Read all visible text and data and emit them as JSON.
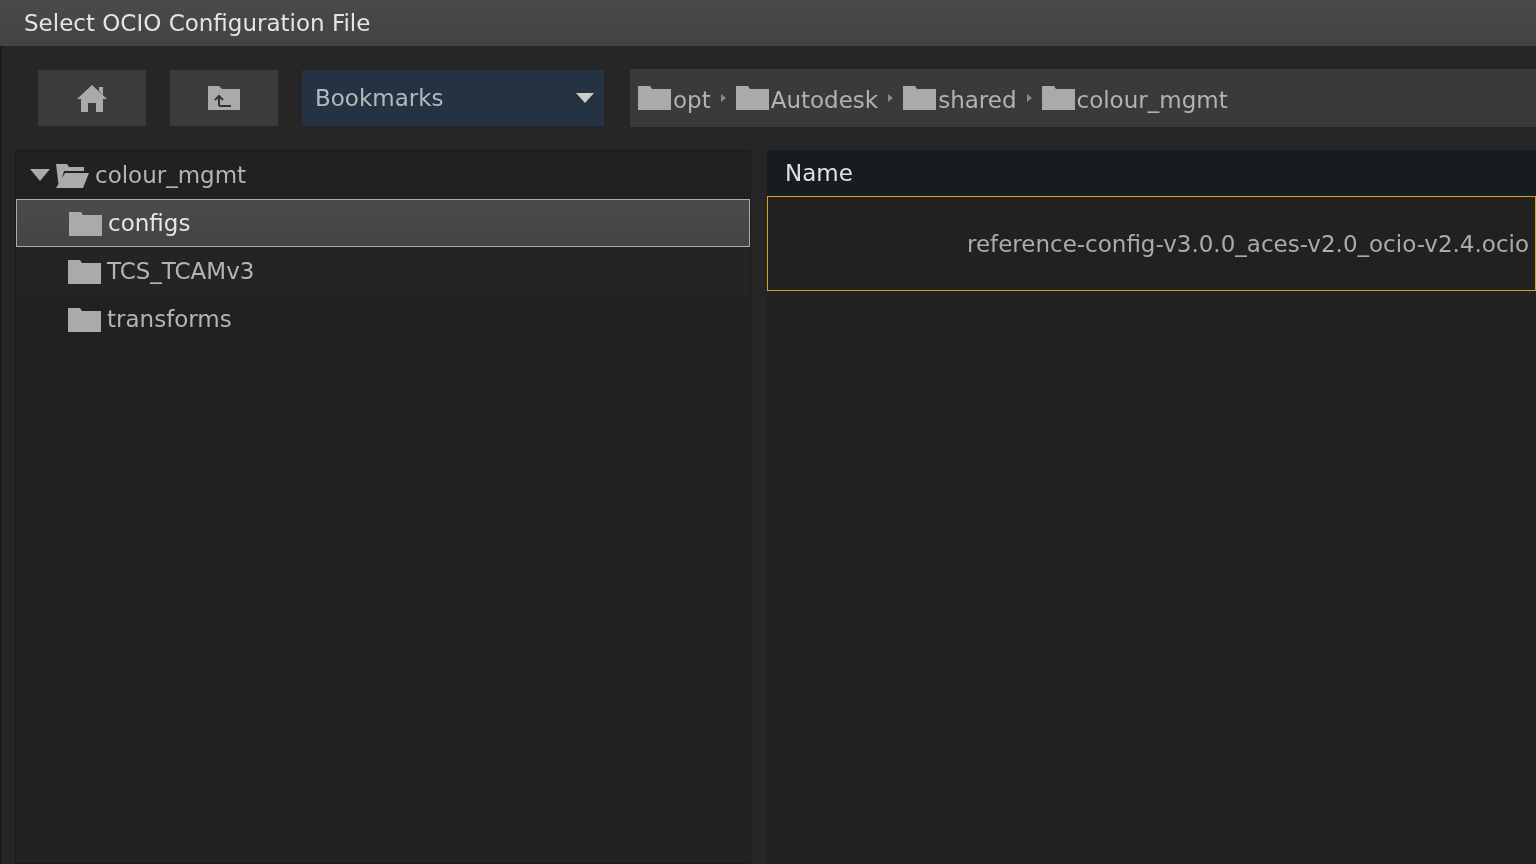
{
  "window": {
    "title": "Select OCIO Configuration File"
  },
  "toolbar": {
    "bookmarks": {
      "value": "Bookmarks"
    },
    "breadcrumbs": [
      {
        "label": "opt"
      },
      {
        "label": "Autodesk"
      },
      {
        "label": "shared"
      },
      {
        "label": "colour_mgmt"
      }
    ]
  },
  "tree": {
    "label": "colour_mgmt",
    "expanded": true,
    "children": [
      {
        "label": "configs",
        "selected": true
      },
      {
        "label": "TCS_TCAMv3",
        "selected": false
      },
      {
        "label": "transforms",
        "selected": false
      }
    ]
  },
  "files": {
    "columns": [
      "Name"
    ],
    "rows": [
      {
        "name": "reference-config-v3.0.0_aces-v2.0_ocio-v2.4.ocio",
        "selected": true
      }
    ]
  }
}
